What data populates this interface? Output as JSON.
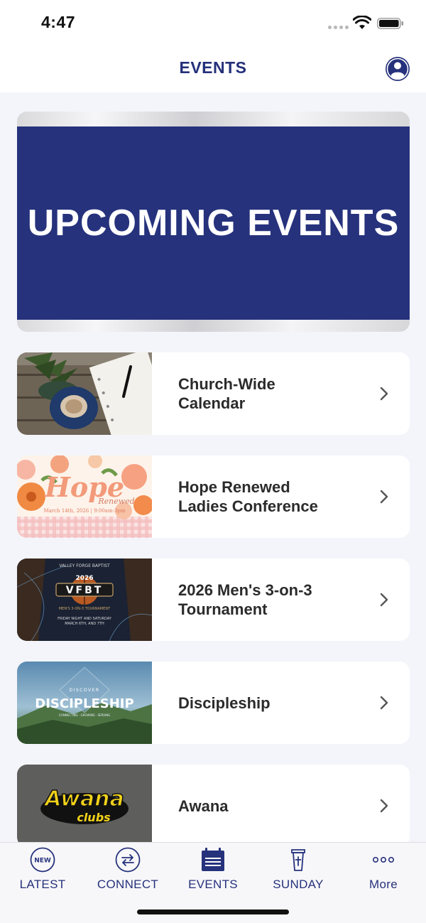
{
  "status_bar": {
    "time": "4:47"
  },
  "header": {
    "title": "EVENTS"
  },
  "banner": {
    "text": "UPCOMING EVENTS"
  },
  "events": [
    {
      "line1": "Church-Wide",
      "line2": "Calendar"
    },
    {
      "line1": "Hope Renewed",
      "line2": "Ladies Conference"
    },
    {
      "line1": "2026 Men's 3-on-3",
      "line2": "Tournament"
    },
    {
      "line1": "Discipleship",
      "line2": ""
    },
    {
      "line1": "Awana",
      "line2": ""
    }
  ],
  "thumbs": {
    "hope_title": "Hope",
    "hope_sub": "Renewed",
    "hope_date": "March 14th, 2026 | 9:00am-3pm",
    "vfbt_top": "VALLEY FORGE BAPTIST",
    "vfbt_year": "2026",
    "vfbt_letters": "VFBT",
    "vfbt_sub": "MEN'S 3-ON-3 TOURNAMENT",
    "vfbt_date1": "FRIDAY NIGHT AND SATURDAY",
    "vfbt_date2": "MARCH 6TH, AND 7TH",
    "disc_top": "DISCOVER",
    "disc_title": "DISCIPLESHIP",
    "disc_sub": "CONNECTING · GROWING · SERVING",
    "awana_line1": "Awana",
    "awana_line2": "clubs"
  },
  "tabs": [
    {
      "label": "LATEST",
      "icon": "new-badge-icon",
      "badge": "NEW"
    },
    {
      "label": "CONNECT",
      "icon": "connect-arrows-icon"
    },
    {
      "label": "EVENTS",
      "icon": "events-list-icon"
    },
    {
      "label": "SUNDAY",
      "icon": "pulpit-icon"
    },
    {
      "label": "More",
      "icon": "more-dots-icon"
    }
  ],
  "colors": {
    "brand_navy": "#26327c",
    "background": "#f3f5fa",
    "card": "#ffffff",
    "text": "#2b2b2b"
  }
}
